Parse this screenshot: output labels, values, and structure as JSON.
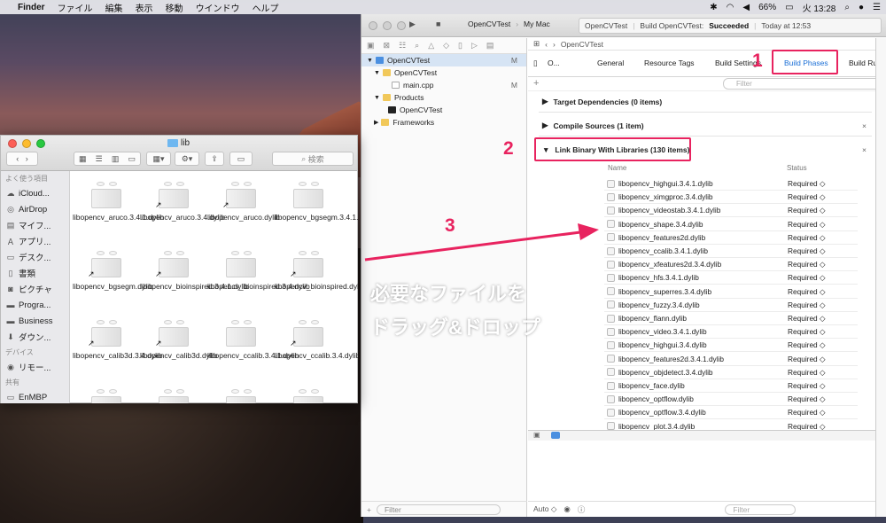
{
  "menubar": {
    "app": "Finder",
    "items": [
      "ファイル",
      "編集",
      "表示",
      "移動",
      "ウインドウ",
      "ヘルプ"
    ],
    "battery": "66%",
    "time": "火 13:28"
  },
  "finder": {
    "title": "lib",
    "search_placeholder": "検索",
    "sidebar": {
      "section_favorites": "よく使う項目",
      "favorites": [
        "iCloud...",
        "AirDrop",
        "マイフ...",
        "アプリ...",
        "デスク...",
        "書類",
        "ピクチャ",
        "Progra...",
        "Business",
        "ダウン..."
      ],
      "section_devices": "デバイス",
      "devices": [
        "リモー..."
      ],
      "section_shared": "共有",
      "shared": [
        "EnMBP"
      ]
    },
    "files": [
      "libopencv_aruco.3.4.1.dylib",
      "libopencv_aruco.3.4.dylib",
      "libopencv_aruco.dylib",
      "libopencv_bgsegm.3.4.1.dylib",
      "libo",
      "libopencv_bgsegm.dylib",
      "libopencv_bioinspired.3.4.1.dylib",
      "libopencv_bioinspired.3.4.dylib",
      "libopencv_bioinspired.dylib",
      "",
      "libopencv_calib3d.3.4.dylib",
      "libopencv_calib3d.dylib",
      "libopencv_ccalib.3.4.1.dylib",
      "libopencv_ccalib.3.4.dylib",
      "libo"
    ]
  },
  "xcode": {
    "scheme": "OpenCVTest",
    "destination": "My Mac",
    "status_project": "OpenCVTest",
    "status_build": "Build OpenCVTest:",
    "status_result": "Succeeded",
    "status_time": "Today at 12:53",
    "navigator": {
      "items": [
        {
          "label": "OpenCVTest",
          "badge": "M"
        },
        {
          "label": "OpenCVTest",
          "badge": ""
        },
        {
          "label": "main.cpp",
          "badge": "M"
        },
        {
          "label": "Products",
          "badge": ""
        },
        {
          "label": "OpenCVTest",
          "badge": ""
        },
        {
          "label": "Frameworks",
          "badge": ""
        }
      ],
      "filter_placeholder": "Filter"
    },
    "jumpbar": "OpenCVTest",
    "target": "O...",
    "tabs": [
      "General",
      "Resource Tags",
      "Build Settings",
      "Build Phases",
      "Build Rul"
    ],
    "filter_placeholder": "Filter",
    "sections": {
      "deps": "Target Dependencies (0 items)",
      "compile": "Compile Sources (1 item)",
      "link": "Link Binary With Libraries (130 items)"
    },
    "columns": {
      "name": "Name",
      "status": "Status"
    },
    "libraries": [
      "libopencv_highgui.3.4.1.dylib",
      "libopencv_ximgproc.3.4.dylib",
      "libopencv_videostab.3.4.1.dylib",
      "libopencv_shape.3.4.dylib",
      "libopencv_features2d.dylib",
      "libopencv_ccalib.3.4.1.dylib",
      "libopencv_xfeatures2d.3.4.dylib",
      "libopencv_hfs.3.4.1.dylib",
      "libopencv_superres.3.4.dylib",
      "libopencv_fuzzy.3.4.dylib",
      "libopencv_flann.dylib",
      "libopencv_video.3.4.1.dylib",
      "libopencv_highgui.3.4.dylib",
      "libopencv_features2d.3.4.1.dylib",
      "libopencv_objdetect.3.4.dylib",
      "libopencv_face.dylib",
      "libopencv_optflow.dylib",
      "libopencv_optflow.3.4.dylib",
      "libopencv_plot.3.4.dylib"
    ],
    "status_value": "Required ◇",
    "bottom_auto": "Auto ◇"
  },
  "annotations": {
    "n1": "1",
    "n2": "2",
    "n3": "3",
    "line1": "必要なファイルを",
    "line2": "ドラッグ&ドロップ",
    "color": "#e8235f"
  }
}
